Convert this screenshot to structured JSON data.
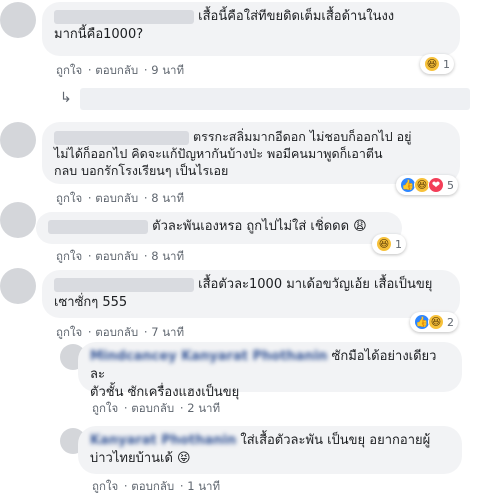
{
  "comments": [
    {
      "id": "c1",
      "text_line1": "เสื้อนี้คือใส่ทีขยดิดเต็มเสื้อด้านในงง",
      "text_line2": "มากนี้คือ1000?",
      "like": "ถูกใจ",
      "reply": "ตอบกลับ",
      "time": "9 นาที",
      "reaction_count": "1"
    },
    {
      "id": "c2",
      "text_line1": "ตรรกะสลิ่มมากอีดอก ไม่ชอบก็ออกไป อยู่",
      "text_line2": "ไม่ได้ก็ออกไป คิดจะแก้ปัญหากันบ้างป่ะ พอมีคนมาพูดก็เอาตีน",
      "text_line3": "กลบ บอกรักโรงเรียนๆ เป็นไรเอย",
      "like": "ถูกใจ",
      "reply": "ตอบกลับ",
      "time": "8 นาที",
      "reaction_count": "5"
    },
    {
      "id": "c3",
      "text_line1": "ตัวละพันเองหรอ ถูกไปไม่ใส่ เชิ่ดดด 😩",
      "like": "ถูกใจ",
      "reply": "ตอบกลับ",
      "time": "8 นาที",
      "reaction_count": "1"
    },
    {
      "id": "c4",
      "text_line1": "เสื้อตัวละ1000 มาเด้อขวัญเอ้ย เสื้อเป็นขยุ",
      "text_line2": "เซาซั่กๆ 555",
      "like": "ถูกใจ",
      "reply": "ตอบกลับ",
      "time": "7 นาที",
      "reaction_count": "2"
    },
    {
      "id": "c5",
      "name_blurred": "Mindcancey Kanyarat Phothanin",
      "text_line1": "ซักมือได้อย่างเดียวละ",
      "text_line2": "ตัวชั้น ซักเครื่องแฮงเป็นขยุ",
      "like": "ถูกใจ",
      "reply": "ตอบกลับ",
      "time": "2 นาที"
    },
    {
      "id": "c6",
      "name_blurred": "Kanyarat Phothanin",
      "text_line1": "ใส่เสื้อตัวละพัน เป็นขยุ อยากอายผู้",
      "text_line2": "บ่าวไทยบ้านเด้ 😝",
      "like": "ถูกใจ",
      "reply": "ตอบกลับ",
      "time": "1 นาที"
    }
  ],
  "icons": {
    "haha": "😆",
    "like": "👍",
    "love": "❤"
  },
  "colors": {
    "bubble": "#f2f3f5",
    "meta": "#606770",
    "link": "#385898"
  }
}
